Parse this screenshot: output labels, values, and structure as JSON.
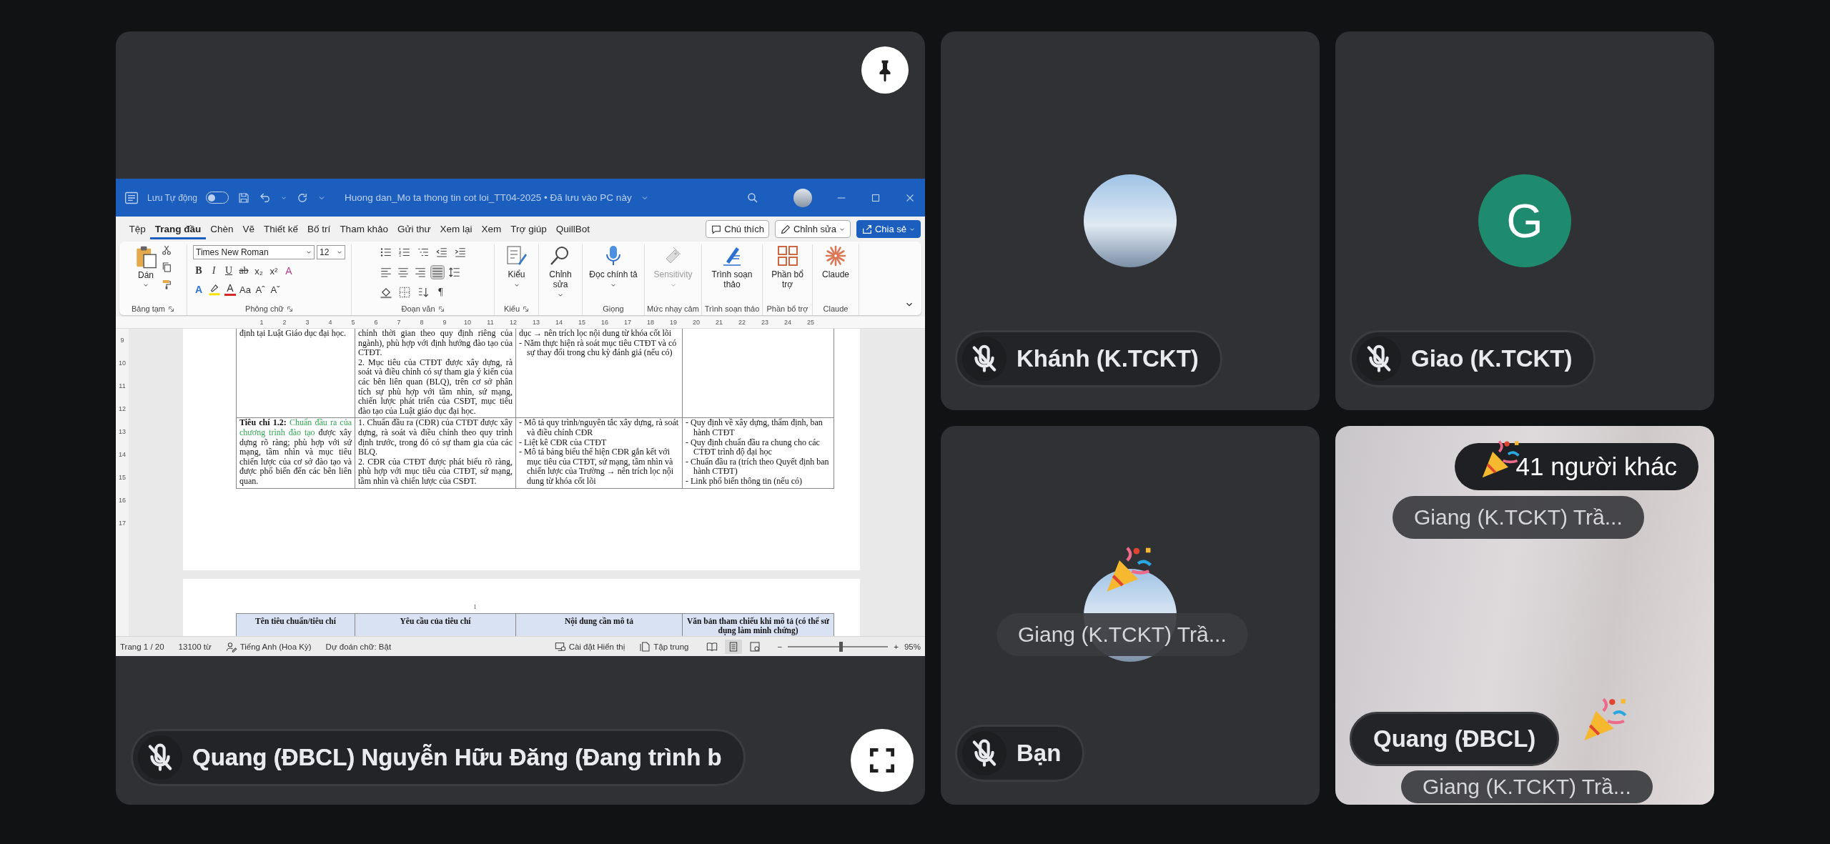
{
  "presentation_tile": {
    "presenter_name": "Quang (ĐBCL) Nguyễn Hữu Đăng (Đang trình b",
    "muted": true
  },
  "word": {
    "title_bar": {
      "autosave_label": "Lưu Tự động",
      "autosave_on": false,
      "document_title": "Huong dan_Mo ta thong tin cot loi_TT04-2025 • Đã lưu vào PC này"
    },
    "tabs": [
      {
        "label": "Tệp",
        "selected": false
      },
      {
        "label": "Trang đầu",
        "selected": true
      },
      {
        "label": "Chèn",
        "selected": false
      },
      {
        "label": "Vẽ",
        "selected": false
      },
      {
        "label": "Thiết kế",
        "selected": false
      },
      {
        "label": "Bố trí",
        "selected": false
      },
      {
        "label": "Tham khảo",
        "selected": false
      },
      {
        "label": "Gửi thư",
        "selected": false
      },
      {
        "label": "Xem lại",
        "selected": false
      },
      {
        "label": "Xem",
        "selected": false
      },
      {
        "label": "Trợ giúp",
        "selected": false
      },
      {
        "label": "QuillBot",
        "selected": false
      }
    ],
    "actions": [
      {
        "label": "Chú thích",
        "kind": "comment"
      },
      {
        "label": "Chỉnh sửa",
        "kind": "edit"
      },
      {
        "label": "Chia sẻ",
        "kind": "share"
      }
    ],
    "clipboard": {
      "label": "Bảng tạm",
      "paste": "Dán"
    },
    "font_group": {
      "label": "Phông chữ",
      "font_name": "Times New Roman",
      "font_size": "12",
      "row1": [
        {
          "kind": "bold",
          "label": "B"
        },
        {
          "kind": "italic",
          "label": "I"
        },
        {
          "kind": "underline",
          "label": "U"
        },
        {
          "kind": "strike",
          "label": "ab"
        },
        {
          "kind": "plain",
          "label": "x₂"
        },
        {
          "kind": "plain",
          "label": "x²"
        },
        {
          "kind": "clear",
          "label": "A"
        }
      ],
      "row2": [
        {
          "kind": "effects",
          "label": "A"
        },
        {
          "kind": "highlight"
        },
        {
          "kind": "color",
          "label": "A"
        },
        {
          "kind": "plain",
          "label": "Aa"
        },
        {
          "kind": "plain",
          "label": "Aˆ"
        },
        {
          "kind": "plain",
          "label": "Aˇ"
        }
      ]
    },
    "paragraph_group": {
      "label": "Đoạn văn",
      "mark": "¶",
      "aligns": [
        {
          "kind": "left",
          "selected": false
        },
        {
          "kind": "center",
          "selected": false
        },
        {
          "kind": "right",
          "selected": false
        },
        {
          "kind": "justify",
          "selected": true
        }
      ]
    },
    "big_groups": [
      {
        "label": "Kiểu",
        "launcher": true,
        "buttons": [
          {
            "label": "Kiểu",
            "kind": "styles",
            "dropdown": true,
            "disabled": false
          }
        ]
      },
      {
        "buttons": [
          {
            "label": "Chỉnh sửa",
            "kind": "editing",
            "dropdown": true,
            "disabled": false
          }
        ]
      },
      {
        "label": "Giọng",
        "buttons": [
          {
            "label": "Đọc chính tả",
            "kind": "dictate",
            "dropdown": true,
            "disabled": false
          }
        ]
      },
      {
        "label": "Mức nhạy cảm",
        "buttons": [
          {
            "label": "Sensitivity",
            "kind": "sensitivity",
            "dropdown": true,
            "disabled": true
          }
        ]
      },
      {
        "label": "Trình soạn thảo",
        "buttons": [
          {
            "label": "Trình soạn thảo",
            "kind": "editor",
            "dropdown": false,
            "disabled": false
          }
        ]
      },
      {
        "label": "Phần bổ trợ",
        "buttons": [
          {
            "label": "Phần bổ trợ",
            "kind": "addins",
            "dropdown": false,
            "disabled": false
          }
        ]
      },
      {
        "label": "Claude",
        "buttons": [
          {
            "label": "Claude",
            "kind": "claude",
            "dropdown": false,
            "disabled": false
          }
        ]
      }
    ],
    "ruler_numbers": [
      "1",
      "2",
      "3",
      "4",
      "5",
      "6",
      "7",
      "8",
      "9",
      "10",
      "11",
      "12",
      "13",
      "14",
      "15",
      "16",
      "17",
      "18",
      "19",
      "20",
      "21",
      "22",
      "23",
      "24",
      "25"
    ],
    "document": {
      "vertical_ruler": [
        "9",
        "10",
        "11",
        "12",
        "13",
        "14",
        "15",
        "16",
        "17"
      ],
      "rows": [
        {
          "cells": [
            {
              "kind": "text",
              "paragraphs": [
                "định tại Luật Giáo dục đại học."
              ]
            },
            {
              "kind": "text",
              "paragraphs": [
                "chỉnh thời gian theo quy định riêng của ngành), phù hợp với định hướng đào tạo của CTĐT.",
                "2. Mục tiêu của CTĐT được xây dựng, rà soát và điều chỉnh có sự tham gia ý kiến của các bên liên quan (BLQ), trên cơ sở phân tích sự phù hợp với tầm nhìn, sứ mạng, chiến lược phát triển của CSĐT, mục tiêu đào tạo của Luật giáo dục đại học."
              ]
            },
            {
              "kind": "text",
              "paragraphs": [
                "dục → nên trích lọc nội dung từ khóa cốt lõi"
              ],
              "bullets": [
                "-  Năm thực hiện rà soát mục tiêu CTĐT và có sự thay đổi  trong chu kỳ đánh giá (nếu có)"
              ]
            }
          ]
        },
        {
          "cells": [
            {
              "kind": "criterion",
              "label": "Tiêu chí 1.2:",
              "highlight": "Chuẩn đầu ra của chương trình đào tạo",
              "text": "được xây dựng rõ ràng; phù hợp với sứ mạng, tầm nhìn và mục tiêu chiến lược của cơ sở đào tạo và được phổ biến đến các bên liên quan."
            },
            {
              "kind": "text",
              "paragraphs": [
                "1. Chuẩn đầu ra (CĐR) của CTĐT được xây dựng, rà soát và điều chỉnh theo quy trình định trước, trong đó có sự tham gia của các BLQ.",
                "2. CĐR của CTĐT được phát biểu rõ ràng, phù hợp với mục tiêu của CTĐT, sứ mạng, tầm nhìn và chiến lược của CSĐT."
              ]
            },
            {
              "kind": "text",
              "bullets": [
                "-  Mô tả quy trình/nguyên tắc xây dựng, rà soát và điều chỉnh CĐR",
                "-  Liệt kê CĐR của CTĐT",
                "-  Mô tả bảng biểu thể hiện CĐR gắn kết với mục tiêu của CTĐT, sứ mạng, tầm nhìn và chiến lược của Trường → nên trích lọc nội dung từ khóa cốt lõi"
              ]
            },
            {
              "kind": "text",
              "bullets": [
                "-  Quy định về xây dựng, thẩm định, ban hành CTĐT",
                "-  Quy định chuẩn đầu ra chung cho các CTĐT trình độ đại học",
                "-  Chuẩn đầu ra (trích theo Quyết định ban hành CTĐT)",
                "-  Link phổ biến thông tin (nếu có)"
              ]
            }
          ]
        }
      ],
      "page_number": "1",
      "header": [
        "Tên tiêu chuẩn/tiêu chí",
        "Yêu cầu của tiêu chí",
        "Nội dung cần mô tả",
        "Văn bản tham chiếu khi mô tả (có thể sử dụng làm minh chứng)"
      ]
    },
    "status_bar": {
      "page": "Trang 1 / 20",
      "words": "13100 từ",
      "language": "Tiếng Anh (Hoa Kỳ)",
      "prediction": "Dự đoán chữ: Bật",
      "display_settings": "Cài đặt Hiển thị",
      "focus": "Tập trung",
      "views": [
        {
          "kind": "read",
          "selected": false
        },
        {
          "kind": "print",
          "selected": true
        },
        {
          "kind": "web",
          "selected": false
        }
      ],
      "zoom_out": "−",
      "zoom_in": "+",
      "zoom": {
        "level": 0.53
      },
      "zoom_reading": "95%"
    }
  },
  "tiles": [
    {
      "kind": "avatar",
      "name": "Khánh (K.TCKT)",
      "muted": true
    },
    {
      "kind": "letter",
      "initial": "G",
      "name": "Giao (K.TCKT)",
      "muted": true
    },
    {
      "kind": "avatar",
      "name": "Bạn",
      "muted": true,
      "reactions": [
        "Giang (K.TCKT) Trầ..."
      ]
    },
    {
      "kind": "video",
      "name": "Quang (ĐBCL)",
      "muted": false,
      "others_count": "41 người khác",
      "reactions": [
        "Giang (K.TCKT) Trầ...",
        "Giang (K.TCKT) Trầ..."
      ]
    }
  ]
}
